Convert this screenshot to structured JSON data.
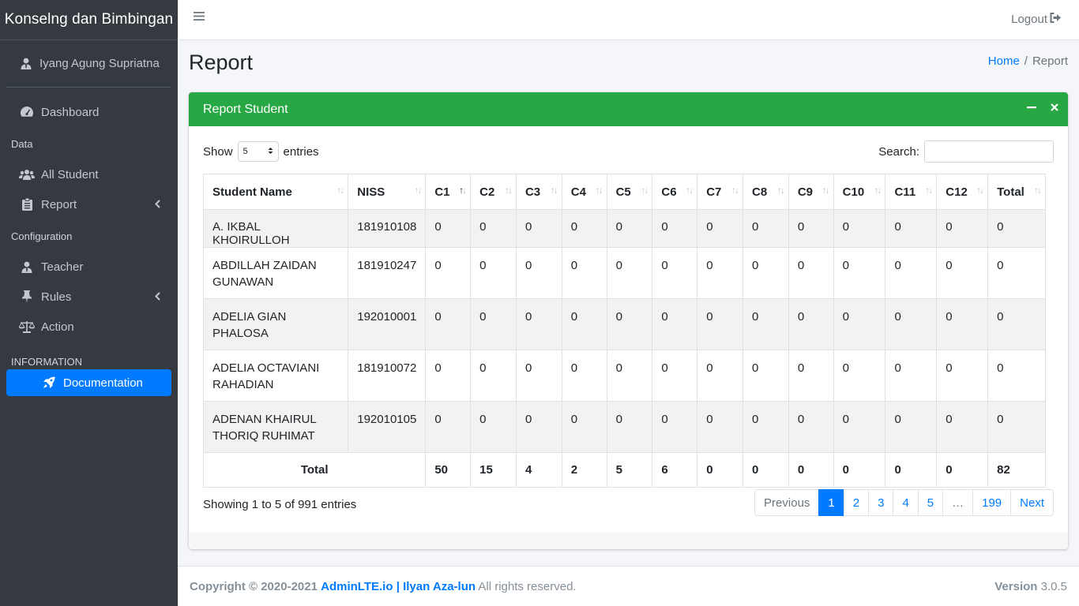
{
  "brand": "Konselng dan Bimbingan",
  "user": {
    "name": "Iyang Agung Supriatna",
    "icon": "user-tie-icon"
  },
  "sidebar": {
    "dashboard": "Dashboard",
    "header_data": "Data",
    "all_student": "All Student",
    "report": "Report",
    "header_config": "Configuration",
    "teacher": "Teacher",
    "rules": "Rules",
    "action": "Action",
    "header_info": "INFORMATION",
    "documentation": "Documentation"
  },
  "topbar": {
    "logout": "Logout"
  },
  "page": {
    "title": "Report",
    "breadcrumb_home": "Home",
    "breadcrumb_sep": "/",
    "breadcrumb_current": "Report"
  },
  "card": {
    "title": "Report Student",
    "show_label": "Show",
    "entries_label": "entries",
    "entries_value": "5",
    "search_label": "Search:",
    "search_value": ""
  },
  "table": {
    "columns": [
      "Student Name",
      "NISS",
      "C1",
      "C2",
      "C3",
      "C4",
      "C5",
      "C6",
      "C7",
      "C8",
      "C9",
      "C10",
      "C11",
      "C12",
      "Total"
    ],
    "rows": [
      [
        "A. IKBAL KHOIRULLOH",
        "181910108",
        "0",
        "0",
        "0",
        "0",
        "0",
        "0",
        "0",
        "0",
        "0",
        "0",
        "0",
        "0",
        "0"
      ],
      [
        "ABDILLAH ZAIDAN GUNAWAN",
        "181910247",
        "0",
        "0",
        "0",
        "0",
        "0",
        "0",
        "0",
        "0",
        "0",
        "0",
        "0",
        "0",
        "0"
      ],
      [
        "ADELIA GIAN PHALOSA",
        "192010001",
        "0",
        "0",
        "0",
        "0",
        "0",
        "0",
        "0",
        "0",
        "0",
        "0",
        "0",
        "0",
        "0"
      ],
      [
        "ADELIA OCTAVIANI RAHADIAN",
        "181910072",
        "0",
        "0",
        "0",
        "0",
        "0",
        "0",
        "0",
        "0",
        "0",
        "0",
        "0",
        "0",
        "0"
      ],
      [
        "ADENAN KHAIRUL THORIQ RUHIMAT",
        "192010105",
        "0",
        "0",
        "0",
        "0",
        "0",
        "0",
        "0",
        "0",
        "0",
        "0",
        "0",
        "0",
        "0"
      ]
    ],
    "footer_label": "Total",
    "footer_values": [
      "50",
      "15",
      "4",
      "2",
      "5",
      "6",
      "0",
      "0",
      "0",
      "0",
      "0",
      "0",
      "82"
    ]
  },
  "info": "Showing 1 to 5 of 991 entries",
  "pagination": {
    "previous": "Previous",
    "pages": [
      "1",
      "2",
      "3",
      "4",
      "5"
    ],
    "ellipsis": "…",
    "last_page": "199",
    "next": "Next",
    "current": "1"
  },
  "footer": {
    "copyright": "Copyright © 2020-2021",
    "link1": "AdminLTE.io",
    "sep": "|",
    "link2": "Ilyan Aza-lun",
    "rights": "All rights reserved.",
    "version_label": "Version",
    "version": "3.0.5"
  },
  "colors": {
    "accent": "#007bff",
    "header": "#28a745",
    "sidebar": "#343a40"
  }
}
